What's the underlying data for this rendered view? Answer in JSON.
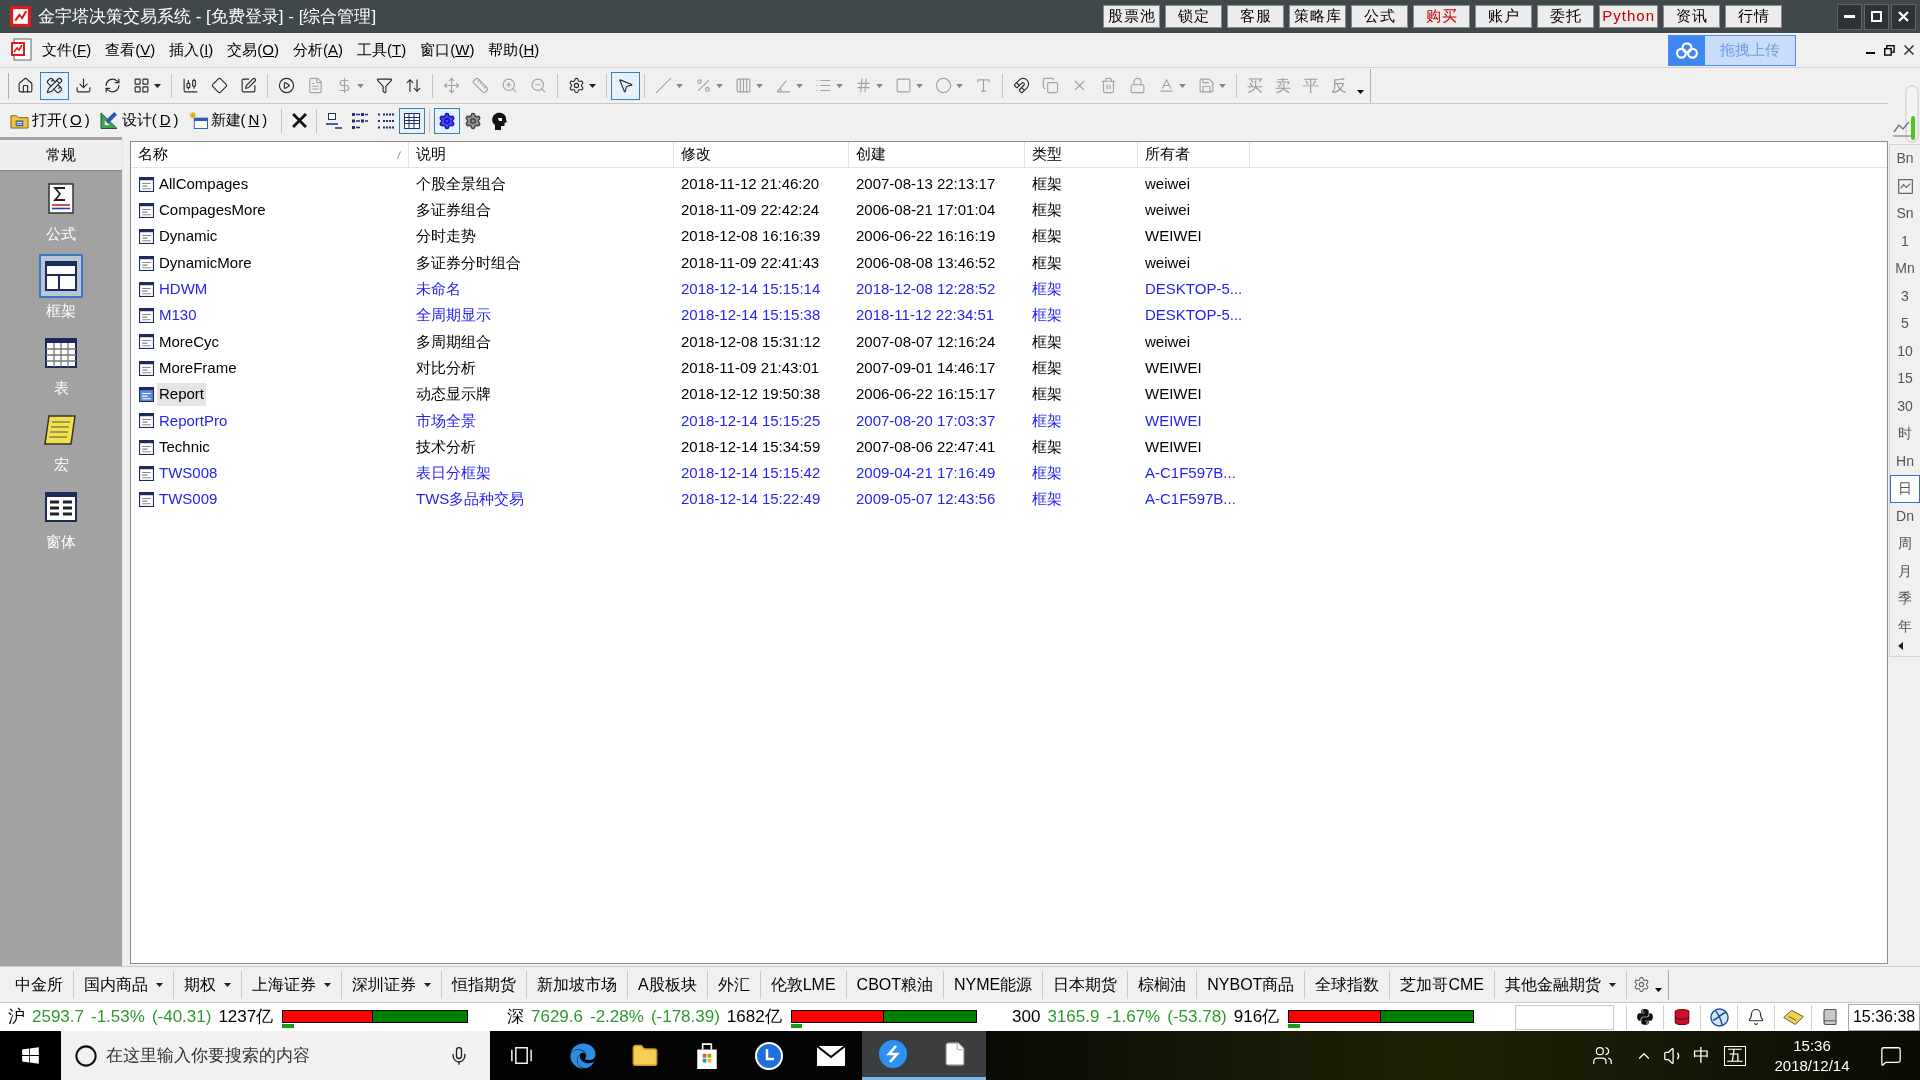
{
  "window": {
    "title": "金宇塔决策交易系统 - [免费登录] - [综合管理]",
    "title_buttons": [
      {
        "label": "股票池",
        "color": "#000000"
      },
      {
        "label": "锁定",
        "color": "#000000"
      },
      {
        "label": "客服",
        "color": "#000000"
      },
      {
        "label": "策略库",
        "color": "#000000"
      },
      {
        "label": "公式",
        "color": "#000000"
      },
      {
        "label": "购买",
        "color": "#c00000"
      },
      {
        "label": "账户",
        "color": "#000000"
      },
      {
        "label": "委托",
        "color": "#000000"
      },
      {
        "label": "Python",
        "color": "#c00000"
      },
      {
        "label": "资讯",
        "color": "#000000"
      },
      {
        "label": "行情",
        "color": "#000000"
      }
    ]
  },
  "menu": {
    "items": [
      "文件(F)",
      "查看(V)",
      "插入(I)",
      "交易(O)",
      "分析(A)",
      "工具(T)",
      "窗口(W)",
      "帮助(H)"
    ],
    "upload_button": "拖拽上传"
  },
  "toolbar": {
    "buttons": [
      {
        "selected": false,
        "dropdown": false,
        "disabled": false
      },
      {
        "selected": true,
        "dropdown": false,
        "disabled": false
      },
      {
        "selected": false,
        "dropdown": false,
        "disabled": false
      },
      {
        "selected": false,
        "dropdown": false,
        "disabled": false
      },
      {
        "selected": false,
        "dropdown": true,
        "disabled": false
      },
      {
        "selected": false,
        "dropdown": false,
        "disabled": false
      },
      {
        "selected": false,
        "dropdown": false,
        "disabled": false
      },
      {
        "selected": false,
        "dropdown": false,
        "disabled": false
      },
      {
        "selected": false,
        "dropdown": false,
        "disabled": false
      },
      {
        "selected": false,
        "dropdown": false,
        "disabled": true
      },
      {
        "selected": false,
        "dropdown": true,
        "disabled": true
      },
      {
        "selected": false,
        "dropdown": false,
        "disabled": false
      },
      {
        "selected": false,
        "dropdown": false,
        "disabled": false
      },
      {
        "selected": false,
        "dropdown": false,
        "disabled": true
      },
      {
        "selected": false,
        "dropdown": false,
        "disabled": true
      },
      {
        "selected": false,
        "dropdown": false,
        "disabled": true
      },
      {
        "selected": false,
        "dropdown": false,
        "disabled": true
      },
      {
        "selected": false,
        "dropdown": true,
        "disabled": false
      },
      {
        "selected": true,
        "dropdown": false,
        "disabled": false
      },
      {
        "selected": false,
        "dropdown": true,
        "disabled": true
      },
      {
        "selected": false,
        "dropdown": true,
        "disabled": true
      },
      {
        "selected": false,
        "dropdown": true,
        "disabled": true
      },
      {
        "selected": false,
        "dropdown": true,
        "disabled": true
      },
      {
        "selected": false,
        "dropdown": true,
        "disabled": true
      },
      {
        "selected": false,
        "dropdown": true,
        "disabled": true
      },
      {
        "selected": false,
        "dropdown": true,
        "disabled": true
      },
      {
        "selected": false,
        "dropdown": true,
        "disabled": true
      },
      {
        "selected": false,
        "dropdown": false,
        "disabled": true
      },
      {
        "selected": false,
        "dropdown": false,
        "disabled": false
      },
      {
        "selected": false,
        "dropdown": false,
        "disabled": true
      },
      {
        "selected": false,
        "dropdown": false,
        "disabled": true
      },
      {
        "selected": false,
        "dropdown": false,
        "disabled": true
      },
      {
        "selected": false,
        "dropdown": false,
        "disabled": true
      },
      {
        "selected": false,
        "dropdown": true,
        "disabled": true
      },
      {
        "selected": false,
        "dropdown": true,
        "disabled": true
      }
    ],
    "text_buttons": [
      {
        "label": "买",
        "disabled": true
      },
      {
        "label": "卖",
        "disabled": true
      },
      {
        "label": "平",
        "disabled": true
      },
      {
        "label": "反",
        "disabled": true
      }
    ]
  },
  "toolbar2": {
    "buttons": [
      "打开(O)",
      "设计(D)",
      "新建(N)"
    ],
    "icon_buttons": [
      {
        "selected": false
      },
      {
        "selected": false
      },
      {
        "selected": false
      },
      {
        "selected": false
      },
      {
        "selected": true
      },
      {
        "selected": true
      },
      {
        "selected": false
      },
      {
        "selected": false
      }
    ]
  },
  "sidebar": {
    "header": "常规",
    "items": [
      {
        "label": "公式",
        "selected": false
      },
      {
        "label": "框架",
        "selected": true
      },
      {
        "label": "表",
        "selected": false
      },
      {
        "label": "宏",
        "selected": false
      },
      {
        "label": "窗体",
        "selected": false
      }
    ]
  },
  "table": {
    "columns": [
      "名称",
      "说明",
      "修改",
      "创建",
      "类型",
      "所有者"
    ],
    "rows": [
      {
        "cells": [
          "AllCompages",
          "个股全景组合",
          "2018-11-12 21:46:20",
          "2007-08-13 22:13:17",
          "框架",
          "weiwei"
        ],
        "color": "#000000",
        "selected": false
      },
      {
        "cells": [
          "CompagesMore",
          "多证券组合",
          "2018-11-09 22:42:24",
          "2006-08-21 17:01:04",
          "框架",
          "weiwei"
        ],
        "color": "#000000",
        "selected": false
      },
      {
        "cells": [
          "Dynamic",
          "分时走势",
          "2018-12-08 16:16:39",
          "2006-06-22 16:16:19",
          "框架",
          "WEIWEI"
        ],
        "color": "#000000",
        "selected": false
      },
      {
        "cells": [
          "DynamicMore",
          "多证券分时组合",
          "2018-11-09 22:41:43",
          "2006-08-08 13:46:52",
          "框架",
          "weiwei"
        ],
        "color": "#000000",
        "selected": false
      },
      {
        "cells": [
          "HDWM",
          "未命名",
          "2018-12-14 15:15:14",
          "2018-12-08 12:28:52",
          "框架",
          "DESKTOP-5..."
        ],
        "color": "#2424f2",
        "selected": false
      },
      {
        "cells": [
          "M130",
          "全周期显示",
          "2018-12-14 15:15:38",
          "2018-11-12 22:34:51",
          "框架",
          "DESKTOP-5..."
        ],
        "color": "#2424f2",
        "selected": false
      },
      {
        "cells": [
          "MoreCyc",
          "多周期组合",
          "2018-12-08 15:31:12",
          "2007-08-07 12:16:24",
          "框架",
          "weiwei"
        ],
        "color": "#000000",
        "selected": false
      },
      {
        "cells": [
          "MoreFrame",
          "对比分析",
          "2018-11-09 21:43:01",
          "2007-09-01 14:46:17",
          "框架",
          "WEIWEI"
        ],
        "color": "#000000",
        "selected": false
      },
      {
        "cells": [
          "Report",
          "动态显示牌",
          "2018-12-12 19:50:38",
          "2006-06-22 16:15:17",
          "框架",
          "WEIWEI"
        ],
        "color": "#000000",
        "selected": true
      },
      {
        "cells": [
          "ReportPro",
          "市场全景",
          "2018-12-14 15:15:25",
          "2007-08-20 17:03:37",
          "框架",
          "WEIWEI"
        ],
        "color": "#2424f2",
        "selected": false
      },
      {
        "cells": [
          "Technic",
          "技术分析",
          "2018-12-14 15:34:59",
          "2007-08-06 22:47:41",
          "框架",
          "WEIWEI"
        ],
        "color": "#000000",
        "selected": false
      },
      {
        "cells": [
          "TWS008",
          "表日分框架",
          "2018-12-14 15:15:42",
          "2009-04-21 17:16:49",
          "框架",
          "A-C1F597B..."
        ],
        "color": "#2424f2",
        "selected": false
      },
      {
        "cells": [
          "TWS009",
          "TWS多品种交易",
          "2018-12-14 15:22:49",
          "2009-05-07 12:43:56",
          "框架",
          "A-C1F597B..."
        ],
        "color": "#2424f2",
        "selected": false
      }
    ]
  },
  "period_bar": {
    "items": [
      {
        "kind": "text",
        "label": "Bn",
        "selected": false
      },
      {
        "kind": "icon",
        "selected": false
      },
      {
        "kind": "text",
        "label": "Sn",
        "selected": false
      },
      {
        "kind": "text",
        "label": "1",
        "selected": false
      },
      {
        "kind": "text",
        "label": "Mn",
        "selected": false
      },
      {
        "kind": "text",
        "label": "3",
        "selected": false
      },
      {
        "kind": "text",
        "label": "5",
        "selected": false
      },
      {
        "kind": "text",
        "label": "10",
        "selected": false
      },
      {
        "kind": "text",
        "label": "15",
        "selected": false
      },
      {
        "kind": "text",
        "label": "30",
        "selected": false
      },
      {
        "kind": "text",
        "label": "时",
        "selected": false
      },
      {
        "kind": "text",
        "label": "Hn",
        "selected": false
      },
      {
        "kind": "text",
        "label": "日",
        "selected": true
      },
      {
        "kind": "text",
        "label": "Dn",
        "selected": false
      },
      {
        "kind": "text",
        "label": "周",
        "selected": false
      },
      {
        "kind": "text",
        "label": "月",
        "selected": false
      },
      {
        "kind": "text",
        "label": "季",
        "selected": false
      },
      {
        "kind": "text",
        "label": "年",
        "selected": false
      }
    ]
  },
  "market_tabs": [
    {
      "label": "中金所",
      "dropdown": false
    },
    {
      "label": "国内商品",
      "dropdown": true
    },
    {
      "label": "期权",
      "dropdown": true
    },
    {
      "label": "上海证券",
      "dropdown": true
    },
    {
      "label": "深圳证券",
      "dropdown": true
    },
    {
      "label": "恒指期货",
      "dropdown": false
    },
    {
      "label": "新加坡市场",
      "dropdown": false
    },
    {
      "label": "A股板块",
      "dropdown": false
    },
    {
      "label": "外汇",
      "dropdown": false
    },
    {
      "label": "伦敦LME",
      "dropdown": false
    },
    {
      "label": "CBOT粮油",
      "dropdown": false
    },
    {
      "label": "NYME能源",
      "dropdown": false
    },
    {
      "label": "日本期货",
      "dropdown": false
    },
    {
      "label": "棕榈油",
      "dropdown": false
    },
    {
      "label": "NYBOT商品",
      "dropdown": false
    },
    {
      "label": "全球指数",
      "dropdown": false
    },
    {
      "label": "芝加哥CME",
      "dropdown": false
    },
    {
      "label": "其他金融期货",
      "dropdown": true
    }
  ],
  "status_bar": {
    "indices": [
      {
        "name": "沪",
        "price": "2593.7",
        "change_pct": "-1.53%",
        "change": "(-40.31)",
        "turnover": "1237亿",
        "bar": {
          "level": 0.49
        },
        "indicator": {
          "level": 0.065
        }
      },
      {
        "name": "深",
        "price": "7629.6",
        "change_pct": "-2.28%",
        "change": "(-178.39)",
        "turnover": "1682亿",
        "bar": {
          "level": 0.5
        },
        "indicator": {
          "level": 0.06
        }
      },
      {
        "name": "300",
        "price": "3165.9",
        "change_pct": "-1.67%",
        "change": "(-53.78)",
        "turnover": "916亿",
        "bar": {
          "level": 0.5
        },
        "indicator": {
          "level": 0.065
        }
      }
    ],
    "clock": "15:36:38"
  },
  "taskbar": {
    "search": {
      "placeholder": "在这里输入你要搜索的内容"
    },
    "apps": [
      {
        "active": false
      },
      {
        "active": false
      },
      {
        "active": false
      },
      {
        "active": false
      },
      {
        "active": false
      },
      {
        "active": false
      },
      {
        "active": true
      },
      {
        "active": true
      }
    ],
    "tray": {
      "ime": "中",
      "input_mode": "五",
      "time": "15:36",
      "date": "2018/12/14"
    }
  }
}
